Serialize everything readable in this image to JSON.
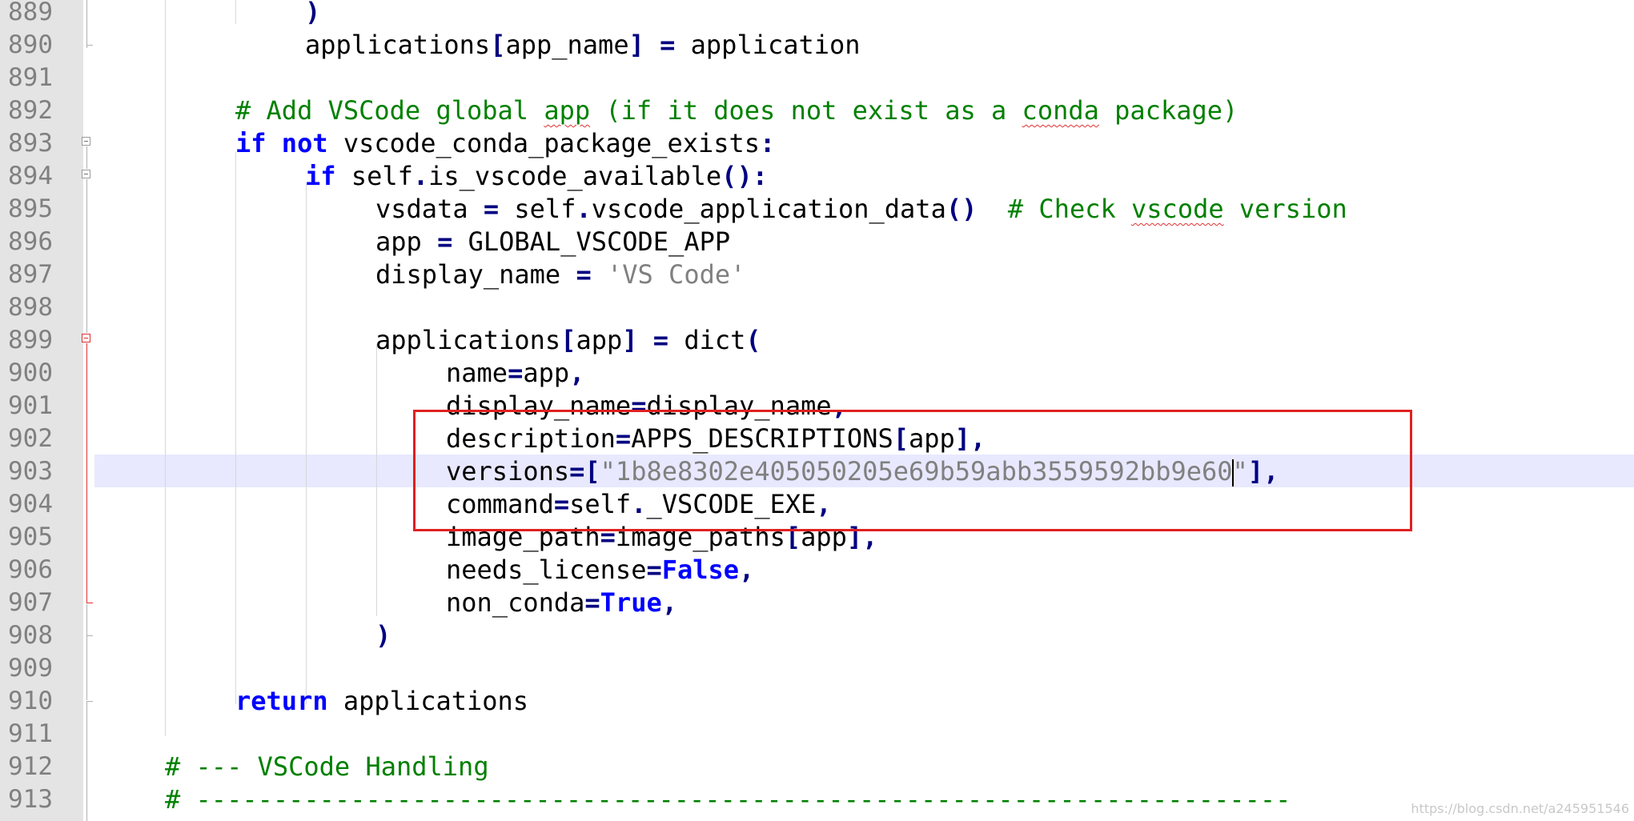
{
  "editor": {
    "line_numbers": [
      "889",
      "890",
      "891",
      "892",
      "893",
      "894",
      "895",
      "896",
      "897",
      "898",
      "899",
      "900",
      "901",
      "902",
      "903",
      "904",
      "905",
      "906",
      "907",
      "908",
      "909",
      "910",
      "911",
      "912",
      "913"
    ],
    "code": {
      "l889_close": ")",
      "l890_a": "applications",
      "l890_b": "[",
      "l890_c": "app_name",
      "l890_d": "]",
      "l890_e": " ",
      "l890_f": "=",
      "l890_g": " application",
      "l892_comment_a": "# Add VSCode global ",
      "l892_comment_app": "app",
      "l892_comment_b": " (if it does not exist as a ",
      "l892_comment_conda": "conda",
      "l892_comment_c": " package)",
      "l893_if": "if",
      "l893_not": "not",
      "l893_rest": " vscode_conda_package_exists",
      "l893_colon": ":",
      "l894_if": "if",
      "l894_a": " self",
      "l894_dot": ".",
      "l894_b": "is_vscode_available",
      "l894_paren": "():",
      "l895_a": "vsdata ",
      "l895_eq": "=",
      "l895_b": " self",
      "l895_dot": ".",
      "l895_c": "vscode_application_data",
      "l895_paren": "()",
      "l895_comment_a": "  # Check ",
      "l895_comment_vscode": "vscode",
      "l895_comment_b": " version",
      "l896_a": "app ",
      "l896_eq": "=",
      "l896_b": " GLOBAL_VSCODE_APP",
      "l897_a": "display_name ",
      "l897_eq": "=",
      "l897_str": " 'VS Code'",
      "l899_a": "applications",
      "l899_b": "[",
      "l899_c": "app",
      "l899_d": "]",
      "l899_eq": " = ",
      "l899_e": "dict",
      "l899_f": "(",
      "l900_a": "name",
      "l900_eq": "=",
      "l900_b": "app",
      "l900_c": ",",
      "l901_a": "display_name",
      "l901_eq": "=",
      "l901_b": "display_name",
      "l901_c": ",",
      "l902_a": "description",
      "l902_eq": "=",
      "l902_b": "APPS_DESCRIPTIONS",
      "l902_c": "[",
      "l902_d": "app",
      "l902_e": "],",
      "l903_a": "versions",
      "l903_eq": "=",
      "l903_b": "[",
      "l903_str": "\"1b8e8302e405050205e69b59abb3559592bb9e60",
      "l903_str_end": "\"",
      "l903_c": "],",
      "l904_a": "command",
      "l904_eq": "=",
      "l904_b": "self",
      "l904_dot": ".",
      "l904_c": "_VSCODE_EXE",
      "l904_d": ",",
      "l905_a": "image_path",
      "l905_eq": "=",
      "l905_b": "image_paths",
      "l905_c": "[",
      "l905_d": "app",
      "l905_e": "],",
      "l906_a": "needs_license",
      "l906_eq": "=",
      "l906_kw": "False",
      "l906_c": ",",
      "l907_a": "non_conda",
      "l907_eq": "=",
      "l907_kw": "True",
      "l907_c": ",",
      "l908_close": ")",
      "l910_kw": "return",
      "l910_b": " applications",
      "l912_comment": "# --- VSCode Handling",
      "l913_comment": "# -----------------------------------------------------------------------"
    }
  },
  "watermark": "https://blog.csdn.net/a245951546",
  "colors": {
    "keyword": "#0000ff",
    "comment": "#008000",
    "string": "#808080",
    "operator": "#000080",
    "highlight_box": "#e02020",
    "current_line": "#e8e8ff"
  }
}
